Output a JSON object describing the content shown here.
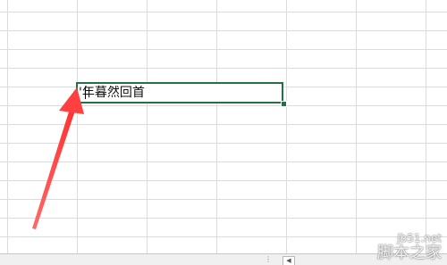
{
  "sheet": {
    "active_cell_text": "'年暮然回首"
  },
  "status_bar": {
    "divider": "⋮",
    "scroll_left_icon": "◀"
  },
  "annotation": {
    "arrow_color": "#ff4b4b"
  },
  "watermark": {
    "url": "jb51.net",
    "name": "脚本之家"
  },
  "colors": {
    "selection_border": "#217346",
    "gridline": "#dadcdd"
  }
}
